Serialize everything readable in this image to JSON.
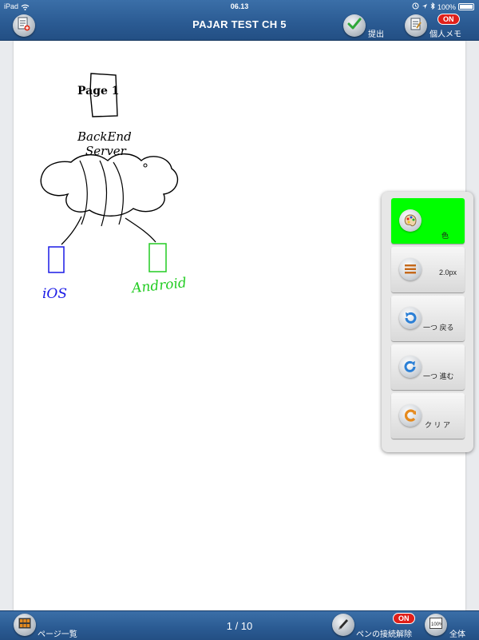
{
  "status": {
    "device": "iPad",
    "time": "06.13",
    "battery": "100%"
  },
  "toolbar": {
    "title": "PAJAR TEST CH 5",
    "submit_label": "提出",
    "memo_label": "個人メモ",
    "memo_badge": "ON"
  },
  "drawing": {
    "page_label": "Page 1",
    "server_line1": "BackEnd",
    "server_line2": "Server",
    "ios_label": "iOS",
    "android_label": "Android"
  },
  "colors": {
    "ink_black": "#000000",
    "ink_blue": "#1a1ae6",
    "ink_green": "#22cc22",
    "color_tile_active": "#00ff00",
    "toolbar_blue": "#2a5a92"
  },
  "palette": {
    "color_label": "色",
    "width_label": "2.0px",
    "undo_label": "一つ 戻る",
    "redo_label": "一つ 進む",
    "clear_label": "ク リ ア"
  },
  "bottom": {
    "page_list_label": "ページ一覧",
    "page_counter": "1 / 10",
    "pen_disconnect_label": "ペンの接続解除",
    "pen_badge": "ON",
    "whole_label": "全体"
  },
  "icons": [
    "page-add-icon",
    "check-icon",
    "memo-icon",
    "palette-icon",
    "line-width-icon",
    "undo-icon",
    "redo-icon",
    "clear-icon",
    "grid-icon",
    "pen-icon",
    "zoom-icon",
    "wifi-icon",
    "bluetooth-icon",
    "location-icon",
    "lock-icon",
    "battery-icon"
  ]
}
